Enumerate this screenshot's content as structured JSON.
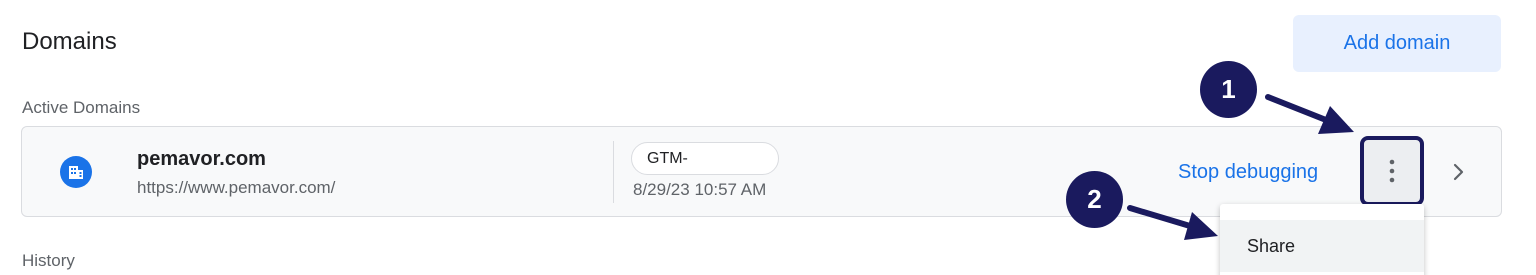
{
  "header": {
    "title": "Domains",
    "add_domain_label": "Add domain"
  },
  "sections": {
    "active_label": "Active Domains",
    "history_label": "History"
  },
  "domain": {
    "name": "pemavor.com",
    "url": "https://www.pemavor.com/",
    "container_id": "GTM-",
    "timestamp": "8/29/23 10:57 AM",
    "stop_label": "Stop debugging",
    "icon": "building-icon"
  },
  "menu": {
    "items": [
      {
        "label": "Share"
      }
    ]
  },
  "annotations": {
    "callout_1": "1",
    "callout_2": "2"
  },
  "colors": {
    "accent": "#1a73e8",
    "callout": "#1a1a5e"
  }
}
